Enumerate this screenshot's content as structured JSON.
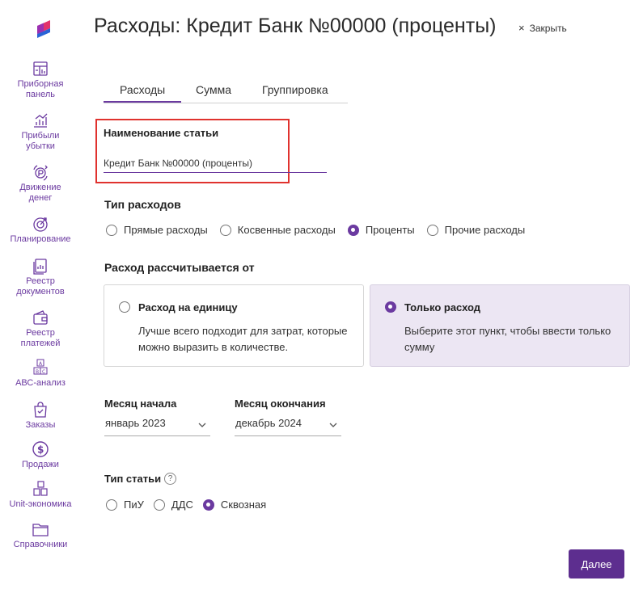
{
  "header": {
    "title": "Расходы: Кредит Банк №00000 (проценты)",
    "close_label": "Закрыть",
    "close_glyph": "×"
  },
  "sidebar": {
    "items": [
      {
        "label": "Приборная\nпанель",
        "icon": "dashboard-icon"
      },
      {
        "label": "Прибыли\nубытки",
        "icon": "chart-bars-icon"
      },
      {
        "label": "Движение\nденег",
        "icon": "money-flow-icon"
      },
      {
        "label": "Планирование",
        "icon": "target-icon"
      },
      {
        "label": "Реестр\nдокументов",
        "icon": "documents-icon"
      },
      {
        "label": "Реестр\nплатежей",
        "icon": "wallet-icon"
      },
      {
        "label": "АВС-анализ",
        "icon": "abc-icon"
      },
      {
        "label": "Заказы",
        "icon": "bag-icon"
      },
      {
        "label": "Продажи",
        "icon": "dollar-icon"
      },
      {
        "label": "Unit-экономика",
        "icon": "cubes-icon"
      },
      {
        "label": "Справочники",
        "icon": "folder-icon"
      }
    ]
  },
  "tabs": [
    {
      "label": "Расходы",
      "active": true
    },
    {
      "label": "Сумма",
      "active": false
    },
    {
      "label": "Группировка",
      "active": false
    }
  ],
  "article": {
    "label": "Наименование статьи",
    "value": "Кредит Банк №00000 (проценты)"
  },
  "expense_type": {
    "label": "Тип расходов",
    "options": [
      {
        "label": "Прямые расходы",
        "checked": false
      },
      {
        "label": "Косвенные расходы",
        "checked": false
      },
      {
        "label": "Проценты",
        "checked": true
      },
      {
        "label": "Прочие расходы",
        "checked": false
      }
    ]
  },
  "calc_basis": {
    "label": "Расход рассчитывается от",
    "cards": [
      {
        "title": "Расход на единицу",
        "desc": "Лучше всего подходит для затрат, которые можно выразить в количестве.",
        "checked": false
      },
      {
        "title": "Только расход",
        "desc": "Выберите этот пункт, чтобы ввести только сумму",
        "checked": true
      }
    ]
  },
  "period": {
    "start_label": "Месяц начала",
    "start_value": "январь 2023",
    "end_label": "Месяц окончания",
    "end_value": "декабрь 2024"
  },
  "article_type": {
    "label": "Тип статьи",
    "help": "?",
    "options": [
      {
        "label": "ПиУ",
        "checked": false
      },
      {
        "label": "ДДС",
        "checked": false
      },
      {
        "label": "Сквозная",
        "checked": true
      }
    ]
  },
  "footer": {
    "next_label": "Далее"
  },
  "colors": {
    "accent": "#6b3aa0",
    "button": "#5d2e8f",
    "highlight": "#e0322e",
    "selected_card": "#ece6f3"
  }
}
